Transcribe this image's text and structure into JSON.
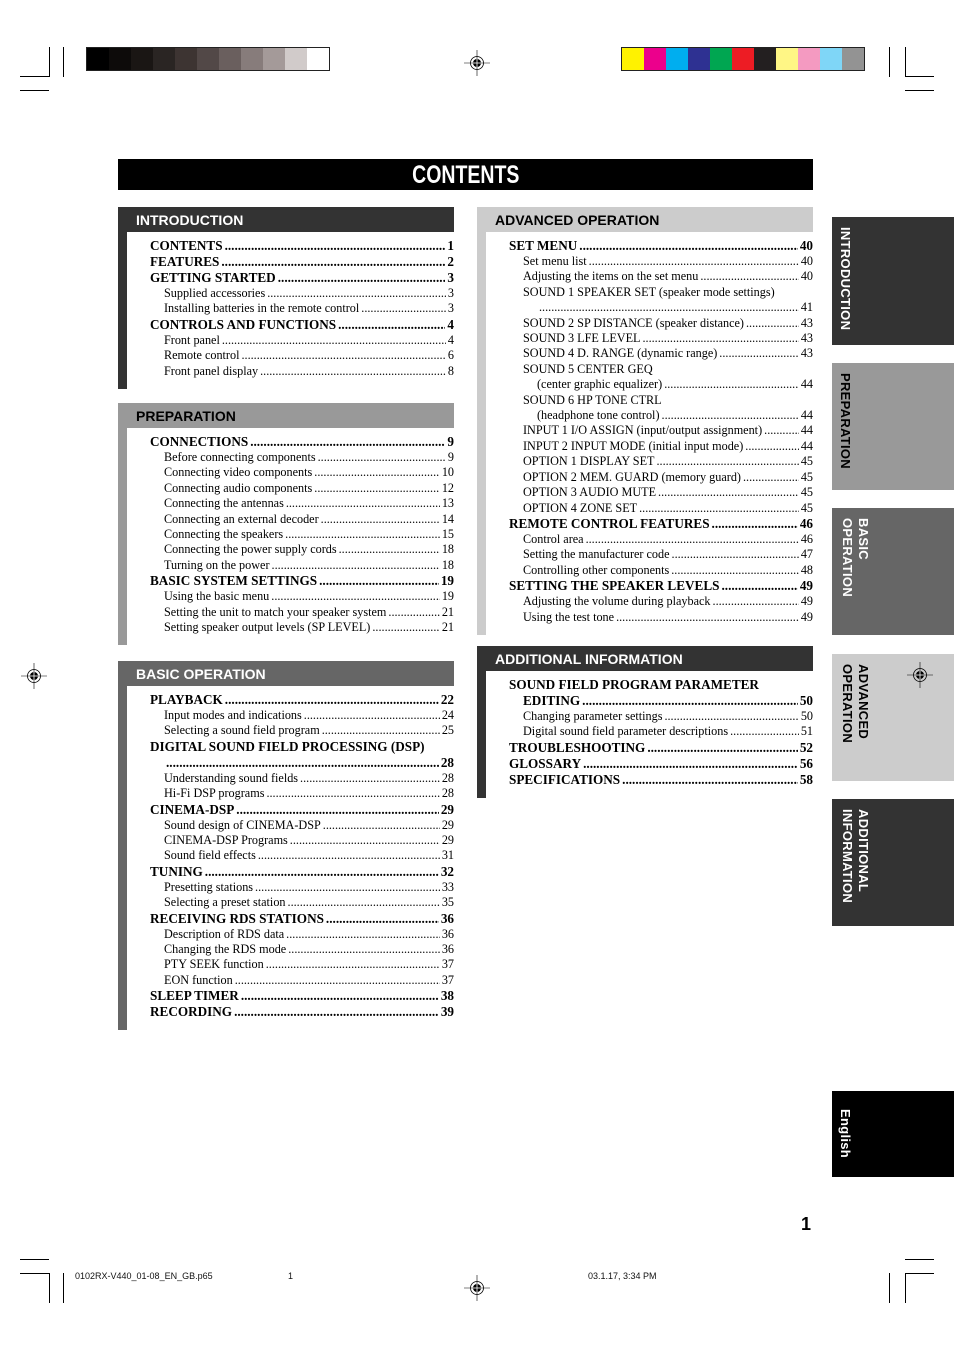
{
  "print_marks": {
    "gray_swatches": [
      "#000000",
      "#0d0b0a",
      "#1a1614",
      "#2a2523",
      "#3d3432",
      "#524847",
      "#6a5f5e",
      "#877c7b",
      "#a49a99",
      "#d1cbca",
      "#ffffff"
    ],
    "color_swatches": [
      "#fff200",
      "#ec008c",
      "#00aeef",
      "#2e3192",
      "#00a651",
      "#ed1c24",
      "#231f20",
      "#fff685",
      "#f49ac1",
      "#7fd6f7",
      "#939393"
    ]
  },
  "title": "CONTENTS",
  "sections": [
    {
      "name": "INTRODUCTION",
      "color": "#333333",
      "entries": [
        {
          "level": "main",
          "label": "CONTENTS",
          "page": "1"
        },
        {
          "level": "main",
          "label": "FEATURES",
          "page": "2"
        },
        {
          "level": "main",
          "label": "GETTING STARTED",
          "page": "3"
        },
        {
          "level": "sub",
          "label": "Supplied accessories",
          "page": "3"
        },
        {
          "level": "sub",
          "label": "Installing batteries in the remote control",
          "page": "3"
        },
        {
          "level": "main",
          "label": "CONTROLS AND FUNCTIONS",
          "page": "4"
        },
        {
          "level": "sub",
          "label": "Front panel",
          "page": "4"
        },
        {
          "level": "sub",
          "label": "Remote control",
          "page": "6"
        },
        {
          "level": "sub",
          "label": "Front panel display",
          "page": "8"
        }
      ]
    },
    {
      "name": "PREPARATION",
      "color": "#999999",
      "entries": [
        {
          "level": "main",
          "label": "CONNECTIONS",
          "page": "9"
        },
        {
          "level": "sub",
          "label": "Before connecting components",
          "page": "9"
        },
        {
          "level": "sub",
          "label": "Connecting video components",
          "page": "10"
        },
        {
          "level": "sub",
          "label": "Connecting audio components",
          "page": "12"
        },
        {
          "level": "sub",
          "label": "Connecting the antennas",
          "page": "13"
        },
        {
          "level": "sub",
          "label": "Connecting an external decoder",
          "page": "14"
        },
        {
          "level": "sub",
          "label": "Connecting the speakers",
          "page": "15"
        },
        {
          "level": "sub",
          "label": "Connecting the power supply cords",
          "page": "18"
        },
        {
          "level": "sub",
          "label": "Turning on the power",
          "page": "18"
        },
        {
          "level": "main",
          "label": "BASIC SYSTEM SETTINGS",
          "page": "19"
        },
        {
          "level": "sub",
          "label": "Using the basic menu",
          "page": "19"
        },
        {
          "level": "sub",
          "label": "Setting the unit to match your speaker system",
          "page": "21"
        },
        {
          "level": "sub",
          "label": "Setting speaker output levels (SP LEVEL)",
          "page": "21"
        }
      ]
    },
    {
      "name": "BASIC OPERATION",
      "color": "#666666",
      "entries": [
        {
          "level": "main",
          "label": "PLAYBACK",
          "page": "22"
        },
        {
          "level": "sub",
          "label": "Input modes and indications",
          "page": "24"
        },
        {
          "level": "sub",
          "label": "Selecting a sound field program",
          "page": "25"
        },
        {
          "level": "main",
          "label": "DIGITAL SOUND FIELD PROCESSING (DSP)",
          "page": ""
        },
        {
          "level": "main-cont",
          "label": "",
          "page": "28"
        },
        {
          "level": "sub",
          "label": "Understanding sound fields",
          "page": "28"
        },
        {
          "level": "sub",
          "label": "Hi-Fi DSP programs",
          "page": "28"
        },
        {
          "level": "main",
          "label": "CINEMA-DSP",
          "page": "29"
        },
        {
          "level": "sub",
          "label": "Sound design of CINEMA-DSP",
          "page": "29"
        },
        {
          "level": "sub",
          "label": "CINEMA-DSP Programs",
          "page": "29"
        },
        {
          "level": "sub",
          "label": "Sound field effects",
          "page": "31"
        },
        {
          "level": "main",
          "label": "TUNING",
          "page": "32"
        },
        {
          "level": "sub",
          "label": "Presetting stations",
          "page": "33"
        },
        {
          "level": "sub",
          "label": "Selecting a preset station",
          "page": "35"
        },
        {
          "level": "main",
          "label": "RECEIVING RDS STATIONS",
          "page": "36"
        },
        {
          "level": "sub",
          "label": "Description of RDS data",
          "page": "36"
        },
        {
          "level": "sub",
          "label": "Changing the RDS mode",
          "page": "36"
        },
        {
          "level": "sub",
          "label": "PTY SEEK function",
          "page": "37"
        },
        {
          "level": "sub",
          "label": "EON function",
          "page": "37"
        },
        {
          "level": "main",
          "label": "SLEEP TIMER",
          "page": "38"
        },
        {
          "level": "main",
          "label": "RECORDING",
          "page": "39"
        }
      ]
    },
    {
      "name": "ADVANCED OPERATION",
      "color": "#cccccc",
      "entries": [
        {
          "level": "main",
          "label": "SET MENU",
          "page": "40"
        },
        {
          "level": "sub",
          "label": "Set menu list",
          "page": "40"
        },
        {
          "level": "sub",
          "label": "Adjusting the items on the set menu",
          "page": "40"
        },
        {
          "level": "sub",
          "label": "SOUND 1 SPEAKER SET (speaker mode settings)",
          "page": ""
        },
        {
          "level": "sub-cont",
          "label": "",
          "page": "41"
        },
        {
          "level": "sub",
          "label": "SOUND 2 SP DISTANCE (speaker distance)",
          "page": "43"
        },
        {
          "level": "sub",
          "label": "SOUND 3 LFE LEVEL",
          "page": "43"
        },
        {
          "level": "sub",
          "label": "SOUND 4 D. RANGE (dynamic range)",
          "page": "43"
        },
        {
          "level": "sub",
          "label": "SOUND 5 CENTER GEQ",
          "page": ""
        },
        {
          "level": "sub-cont",
          "label": "(center graphic equalizer)",
          "page": "44"
        },
        {
          "level": "sub",
          "label": "SOUND 6 HP TONE CTRL",
          "page": ""
        },
        {
          "level": "sub-cont",
          "label": "(headphone tone control)",
          "page": "44"
        },
        {
          "level": "sub",
          "label": "INPUT 1 I/O ASSIGN (input/output assignment)",
          "page": "44"
        },
        {
          "level": "sub",
          "label": "INPUT 2 INPUT MODE (initial input mode)",
          "page": "44"
        },
        {
          "level": "sub",
          "label": "OPTION 1 DISPLAY SET",
          "page": "45"
        },
        {
          "level": "sub",
          "label": "OPTION 2 MEM. GUARD (memory guard)",
          "page": "45"
        },
        {
          "level": "sub",
          "label": "OPTION 3 AUDIO MUTE",
          "page": "45"
        },
        {
          "level": "sub",
          "label": "OPTION 4 ZONE SET",
          "page": "45"
        },
        {
          "level": "main",
          "label": "REMOTE CONTROL FEATURES",
          "page": "46"
        },
        {
          "level": "sub",
          "label": "Control area",
          "page": "46"
        },
        {
          "level": "sub",
          "label": "Setting the manufacturer code",
          "page": "47"
        },
        {
          "level": "sub",
          "label": "Controlling other components",
          "page": "48"
        },
        {
          "level": "main",
          "label": "SETTING THE SPEAKER LEVELS",
          "page": "49"
        },
        {
          "level": "sub",
          "label": "Adjusting the volume during playback",
          "page": "49"
        },
        {
          "level": "sub",
          "label": "Using the test tone",
          "page": "49"
        }
      ]
    },
    {
      "name": "ADDITIONAL INFORMATION",
      "color": "#333333",
      "entries": [
        {
          "level": "main",
          "label": "SOUND FIELD PROGRAM PARAMETER",
          "page": ""
        },
        {
          "level": "main-cont",
          "label": "EDITING",
          "page": "50"
        },
        {
          "level": "sub",
          "label": "Changing parameter settings",
          "page": "50"
        },
        {
          "level": "sub",
          "label": "Digital sound field parameter descriptions",
          "page": "51"
        },
        {
          "level": "main",
          "label": "TROUBLESHOOTING",
          "page": "52"
        },
        {
          "level": "main",
          "label": "GLOSSARY",
          "page": "56"
        },
        {
          "level": "main",
          "label": "SPECIFICATIONS",
          "page": "58"
        }
      ]
    }
  ],
  "side_tabs": [
    {
      "label": "INTRODUCTION",
      "color": "#333333",
      "text_color": "#ffffff"
    },
    {
      "label": "PREPARATION",
      "color": "#999999",
      "text_color": "#000000"
    },
    {
      "label": "BASIC OPERATION",
      "color": "#666666",
      "text_color": "#ffffff"
    },
    {
      "label": "ADVANCED OPERATION",
      "color": "#cccccc",
      "text_color": "#000000"
    },
    {
      "label": "ADDITIONAL INFORMATION",
      "color": "#333333",
      "text_color": "#ffffff"
    },
    {
      "label": "English",
      "color": "#000000",
      "text_color": "#ffffff"
    }
  ],
  "page_number": "1",
  "footer": {
    "filename": "0102RX-V440_01-08_EN_GB.p65",
    "page": "1",
    "timestamp": "03.1.17, 3:34 PM"
  }
}
